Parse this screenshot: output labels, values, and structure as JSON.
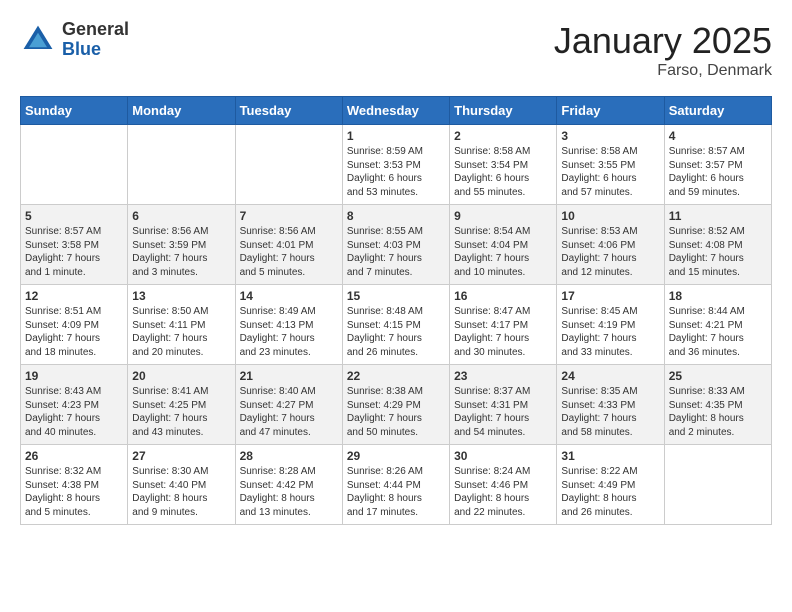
{
  "header": {
    "logo_general": "General",
    "logo_blue": "Blue",
    "title": "January 2025",
    "subtitle": "Farso, Denmark"
  },
  "weekdays": [
    "Sunday",
    "Monday",
    "Tuesday",
    "Wednesday",
    "Thursday",
    "Friday",
    "Saturday"
  ],
  "weeks": [
    [
      {
        "day": "",
        "info": ""
      },
      {
        "day": "",
        "info": ""
      },
      {
        "day": "",
        "info": ""
      },
      {
        "day": "1",
        "info": "Sunrise: 8:59 AM\nSunset: 3:53 PM\nDaylight: 6 hours\nand 53 minutes."
      },
      {
        "day": "2",
        "info": "Sunrise: 8:58 AM\nSunset: 3:54 PM\nDaylight: 6 hours\nand 55 minutes."
      },
      {
        "day": "3",
        "info": "Sunrise: 8:58 AM\nSunset: 3:55 PM\nDaylight: 6 hours\nand 57 minutes."
      },
      {
        "day": "4",
        "info": "Sunrise: 8:57 AM\nSunset: 3:57 PM\nDaylight: 6 hours\nand 59 minutes."
      }
    ],
    [
      {
        "day": "5",
        "info": "Sunrise: 8:57 AM\nSunset: 3:58 PM\nDaylight: 7 hours\nand 1 minute."
      },
      {
        "day": "6",
        "info": "Sunrise: 8:56 AM\nSunset: 3:59 PM\nDaylight: 7 hours\nand 3 minutes."
      },
      {
        "day": "7",
        "info": "Sunrise: 8:56 AM\nSunset: 4:01 PM\nDaylight: 7 hours\nand 5 minutes."
      },
      {
        "day": "8",
        "info": "Sunrise: 8:55 AM\nSunset: 4:03 PM\nDaylight: 7 hours\nand 7 minutes."
      },
      {
        "day": "9",
        "info": "Sunrise: 8:54 AM\nSunset: 4:04 PM\nDaylight: 7 hours\nand 10 minutes."
      },
      {
        "day": "10",
        "info": "Sunrise: 8:53 AM\nSunset: 4:06 PM\nDaylight: 7 hours\nand 12 minutes."
      },
      {
        "day": "11",
        "info": "Sunrise: 8:52 AM\nSunset: 4:08 PM\nDaylight: 7 hours\nand 15 minutes."
      }
    ],
    [
      {
        "day": "12",
        "info": "Sunrise: 8:51 AM\nSunset: 4:09 PM\nDaylight: 7 hours\nand 18 minutes."
      },
      {
        "day": "13",
        "info": "Sunrise: 8:50 AM\nSunset: 4:11 PM\nDaylight: 7 hours\nand 20 minutes."
      },
      {
        "day": "14",
        "info": "Sunrise: 8:49 AM\nSunset: 4:13 PM\nDaylight: 7 hours\nand 23 minutes."
      },
      {
        "day": "15",
        "info": "Sunrise: 8:48 AM\nSunset: 4:15 PM\nDaylight: 7 hours\nand 26 minutes."
      },
      {
        "day": "16",
        "info": "Sunrise: 8:47 AM\nSunset: 4:17 PM\nDaylight: 7 hours\nand 30 minutes."
      },
      {
        "day": "17",
        "info": "Sunrise: 8:45 AM\nSunset: 4:19 PM\nDaylight: 7 hours\nand 33 minutes."
      },
      {
        "day": "18",
        "info": "Sunrise: 8:44 AM\nSunset: 4:21 PM\nDaylight: 7 hours\nand 36 minutes."
      }
    ],
    [
      {
        "day": "19",
        "info": "Sunrise: 8:43 AM\nSunset: 4:23 PM\nDaylight: 7 hours\nand 40 minutes."
      },
      {
        "day": "20",
        "info": "Sunrise: 8:41 AM\nSunset: 4:25 PM\nDaylight: 7 hours\nand 43 minutes."
      },
      {
        "day": "21",
        "info": "Sunrise: 8:40 AM\nSunset: 4:27 PM\nDaylight: 7 hours\nand 47 minutes."
      },
      {
        "day": "22",
        "info": "Sunrise: 8:38 AM\nSunset: 4:29 PM\nDaylight: 7 hours\nand 50 minutes."
      },
      {
        "day": "23",
        "info": "Sunrise: 8:37 AM\nSunset: 4:31 PM\nDaylight: 7 hours\nand 54 minutes."
      },
      {
        "day": "24",
        "info": "Sunrise: 8:35 AM\nSunset: 4:33 PM\nDaylight: 7 hours\nand 58 minutes."
      },
      {
        "day": "25",
        "info": "Sunrise: 8:33 AM\nSunset: 4:35 PM\nDaylight: 8 hours\nand 2 minutes."
      }
    ],
    [
      {
        "day": "26",
        "info": "Sunrise: 8:32 AM\nSunset: 4:38 PM\nDaylight: 8 hours\nand 5 minutes."
      },
      {
        "day": "27",
        "info": "Sunrise: 8:30 AM\nSunset: 4:40 PM\nDaylight: 8 hours\nand 9 minutes."
      },
      {
        "day": "28",
        "info": "Sunrise: 8:28 AM\nSunset: 4:42 PM\nDaylight: 8 hours\nand 13 minutes."
      },
      {
        "day": "29",
        "info": "Sunrise: 8:26 AM\nSunset: 4:44 PM\nDaylight: 8 hours\nand 17 minutes."
      },
      {
        "day": "30",
        "info": "Sunrise: 8:24 AM\nSunset: 4:46 PM\nDaylight: 8 hours\nand 22 minutes."
      },
      {
        "day": "31",
        "info": "Sunrise: 8:22 AM\nSunset: 4:49 PM\nDaylight: 8 hours\nand 26 minutes."
      },
      {
        "day": "",
        "info": ""
      }
    ]
  ]
}
